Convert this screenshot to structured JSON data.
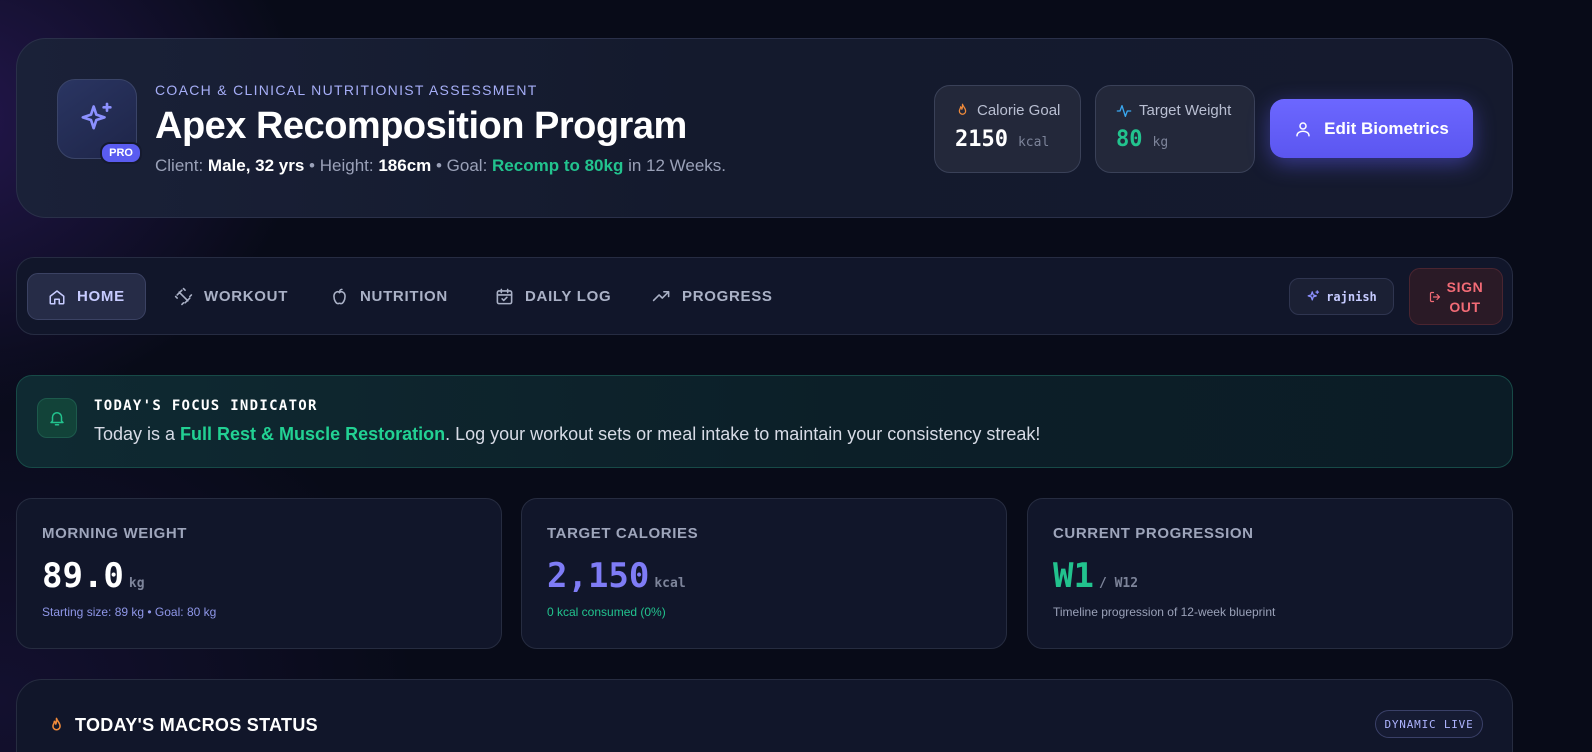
{
  "header": {
    "eyebrow": "COACH & CLINICAL NUTRITIONIST ASSESSMENT",
    "title": "Apex Recomposition Program",
    "badge": "PRO",
    "client_prefix": "Client:",
    "client_value": "Male, 32 yrs",
    "height_prefix": " • Height:",
    "height_value": "186cm",
    "goal_prefix": " • Goal:",
    "goal_value": "Recomp to 80kg",
    "goal_suffix": " in 12 Weeks.",
    "calorie_goal": {
      "label": "Calorie Goal",
      "value": "2150",
      "unit": "kcal",
      "icon": "flame-icon",
      "color": "#f08a3a"
    },
    "target_weight": {
      "label": "Target Weight",
      "value": "80",
      "unit": "kg",
      "icon": "pulse-icon",
      "color": "#22c38e"
    },
    "edit_button": "Edit Biometrics"
  },
  "nav": {
    "items": [
      {
        "label": "HOME",
        "icon": "home-icon"
      },
      {
        "label": "WORKOUT",
        "icon": "dumbbell-icon"
      },
      {
        "label": "NUTRITION",
        "icon": "apple-icon"
      },
      {
        "label": "DAILY LOG",
        "icon": "calendar-check-icon"
      },
      {
        "label": "PROGRESS",
        "icon": "trending-up-icon"
      }
    ],
    "active": "HOME",
    "user": "rajnish",
    "sign_out_line1": "SIGN",
    "sign_out_line2": "OUT"
  },
  "focus": {
    "title": "TODAY'S FOCUS INDICATOR",
    "text_prefix": "Today is a ",
    "highlight": "Full Rest & Muscle Restoration",
    "text_suffix": ". Log your workout sets or meal intake to maintain your consistency streak!"
  },
  "cards": [
    {
      "label": "MORNING WEIGHT",
      "value": "89.0",
      "unit": "kg",
      "sub": "Starting size: 89 kg • Goal: 80 kg",
      "value_color": "#ffffff",
      "sub_color": "#8f97e8"
    },
    {
      "label": "TARGET CALORIES",
      "value": "2,150",
      "unit": "kcal",
      "sub": "0 kcal consumed (0%)",
      "value_color": "#7f7cf6",
      "sub_color": "#22c38e"
    },
    {
      "label": "CURRENT PROGRESSION",
      "value": "W1",
      "unit": "/ W12",
      "sub": "Timeline progression of 12-week blueprint",
      "value_color": "#22c38e",
      "sub_color": "#9aa1b8"
    }
  ],
  "macros": {
    "title": "TODAY'S MACROS STATUS",
    "badge": "DYNAMIC LIVE"
  }
}
